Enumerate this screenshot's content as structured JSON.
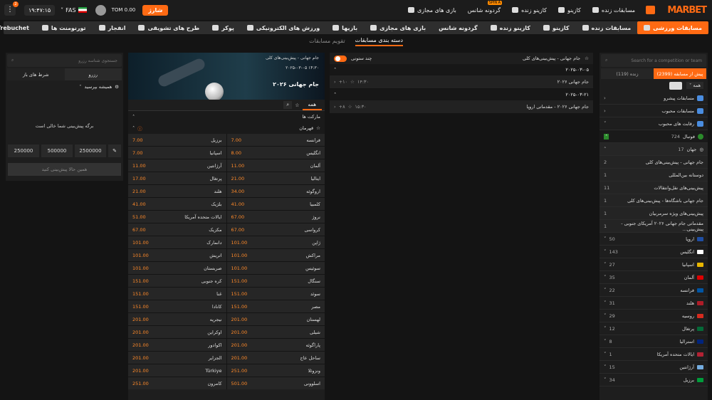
{
  "header": {
    "logo": "MARBET",
    "charge": "شارژ",
    "balance": "TOM 0.00",
    "lang": "FAS",
    "clock": "۱۹:۴۷:۱۵",
    "kebab": "⋮",
    "notif": "2",
    "menu": [
      "مسابقات ورزشی",
      "مسابقات زنده",
      "کازینو",
      "کازینو زنده",
      "گردونه شانس",
      "بازی های مجازی",
      "بازیها",
      "ورزش های الکترونیکی",
      "پوکر",
      "طرح های تشویقی",
      "انفجار",
      "تورنومنت ها",
      "Trebuchet"
    ],
    "spin_badge": "SPIN A"
  },
  "subtabs": [
    "دسته بندی مسابقات",
    "تقویم مسابقات"
  ],
  "right": {
    "search_placeholder": "Search for a competition or team",
    "live": "زنده (119)",
    "prematch": "پیش از مسابقه (2399)",
    "filter": "همه",
    "sections": [
      "مسابقات پیشرو",
      "مسابقات محبوب",
      "رقابت های محبوب"
    ],
    "sport": "فوتبال",
    "sport_count": "724",
    "region": "جهان",
    "region_count": "17",
    "leagues": [
      {
        "name": "جام جهانی - پیش‌بینی‌های کلی",
        "count": "2"
      },
      {
        "name": "دوستانه بین‌المللی",
        "count": "1"
      },
      {
        "name": "پیش‌بینی‌های نقل‌وانتقالات",
        "count": "11"
      },
      {
        "name": "جام جهانی باشگاه‌ها - پیش‌بینی‌های کلی",
        "count": "1"
      },
      {
        "name": "پیش‌بینی‌های ویژه سرمربیان",
        "count": "1"
      },
      {
        "name": "مقدماتی جام جهانی ۲۰۲۶ آمریکای جنوبی - پیش‌بینی...",
        "count": "1"
      }
    ],
    "countries": [
      {
        "name": "اروپا",
        "count": "50",
        "c": "#1f4ea3"
      },
      {
        "name": "انگلیس",
        "count": "143",
        "c": "#ffffff"
      },
      {
        "name": "اسپانیا",
        "count": "27",
        "c": "#e8b600"
      },
      {
        "name": "آلمان",
        "count": "35",
        "c": "#dd0000"
      },
      {
        "name": "فرانسه",
        "count": "22",
        "c": "#0055a4"
      },
      {
        "name": "هلند",
        "count": "31",
        "c": "#ae1c28"
      },
      {
        "name": "روسیه",
        "count": "29",
        "c": "#d52b1e"
      },
      {
        "name": "پرتغال",
        "count": "12",
        "c": "#046a38"
      },
      {
        "name": "استرالیا",
        "count": "8",
        "c": "#00247d"
      },
      {
        "name": "ایالات متحده آمریکا",
        "count": "1",
        "c": "#b22234"
      },
      {
        "name": "آرژانتین",
        "count": "15",
        "c": "#74acdf"
      },
      {
        "name": "برزیل",
        "count": "34",
        "c": "#009c3b"
      }
    ]
  },
  "mid": {
    "title": "جام جهانی - پیش‌بینی‌های کلی",
    "multi": "چند ستونی",
    "groups": [
      {
        "date": "۲۰۲۵-۰۳-۰۵",
        "event": "جام جهانی ۲۰۲۶",
        "time": "۱۴:۳۰",
        "plus": "۱۰+"
      },
      {
        "date": "۲۰۲۵-۰۳-۲۱",
        "event": "جام جهانی ۲۰۲۶ - مقدماتی اروپا",
        "time": "۱۵:۳۰",
        "plus": "۸+"
      }
    ]
  },
  "odds": {
    "top": "جام جهانی - پیش‌بینی‌های کلی",
    "date": "۲۰۲۵-۰۳-۰۵ ۱۴:۳۰",
    "title": "جام جهانی ۲۰۲۶",
    "tab": "همه",
    "markets": "مارکت ها",
    "champion": "قهرمان",
    "rows": [
      [
        "برزیل",
        "7.00",
        "فرانسه",
        "7.00"
      ],
      [
        "اسپانیا",
        "7.00",
        "انگلیس",
        "8.00"
      ],
      [
        "آرژانتین",
        "11.00",
        "آلمان",
        "11.00"
      ],
      [
        "پرتغال",
        "17.00",
        "ایتالیا",
        "21.00"
      ],
      [
        "هلند",
        "21.00",
        "اروگوئه",
        "34.00"
      ],
      [
        "بلژیک",
        "41.00",
        "کلمبیا",
        "41.00"
      ],
      [
        "ایالات متحده آمریکا",
        "51.00",
        "نروژ",
        "67.00"
      ],
      [
        "مکزیک",
        "67.00",
        "کرواسی",
        "67.00"
      ],
      [
        "دانمارک",
        "101.00",
        "ژاپن",
        "101.00"
      ],
      [
        "اتریش",
        "101.00",
        "مراکش",
        "101.00"
      ],
      [
        "صربستان",
        "101.00",
        "سوئیس",
        "101.00"
      ],
      [
        "کره جنوبی",
        "151.00",
        "سنگال",
        "151.00"
      ],
      [
        "غنا",
        "151.00",
        "سوئد",
        "151.00"
      ],
      [
        "کانادا",
        "151.00",
        "مصر",
        "151.00"
      ],
      [
        "نیجریه",
        "201.00",
        "لهستان",
        "201.00"
      ],
      [
        "اوکراین",
        "201.00",
        "شیلی",
        "201.00"
      ],
      [
        "اکوادور",
        "201.00",
        "پاراگوئه",
        "201.00"
      ],
      [
        "الجزایر",
        "201.00",
        "ساحل عاج",
        "201.00"
      ],
      [
        "Türkiye",
        "201.00",
        "ونزوئلا",
        "251.00"
      ],
      [
        "کامرون",
        "251.00",
        "اسلوونی",
        "501.00"
      ]
    ]
  },
  "left": {
    "search_placeholder": "جستجوی شناسه رزرو",
    "tab1": "رزرو",
    "tab2": "شرط های باز",
    "always_ask": "همیشه بپرسید",
    "empty": "برگه پیش‌بینی شما خالی است",
    "amounts": [
      "250000",
      "500000",
      "2500000"
    ],
    "place": "همین حالا پیش‌بینی کنید"
  }
}
